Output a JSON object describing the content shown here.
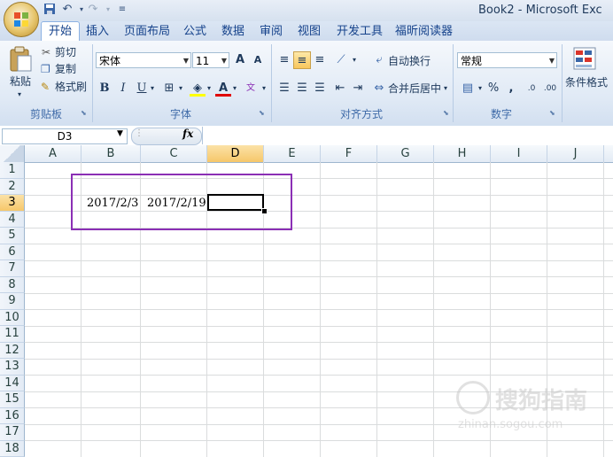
{
  "window": {
    "title": "Book2 - Microsoft Exc"
  },
  "tabs": [
    "开始",
    "插入",
    "页面布局",
    "公式",
    "数据",
    "审阅",
    "视图",
    "开发工具",
    "福昕阅读器"
  ],
  "ribbon": {
    "clipboard": {
      "paste": "粘贴",
      "cut": "剪切",
      "copy": "复制",
      "format_painter": "格式刷",
      "label": "剪贴板"
    },
    "font": {
      "name": "宋体",
      "size": "11",
      "bold": "B",
      "italic": "I",
      "underline": "U",
      "grow": "A",
      "shrink": "A",
      "label": "字体"
    },
    "alignment": {
      "wrap": "自动换行",
      "merge": "合并后居中",
      "label": "对齐方式"
    },
    "number": {
      "format": "常规",
      "percent": "%",
      "comma": ",",
      "inc_decimal": ".0",
      "dec_decimal": ".00",
      "label": "数字"
    },
    "styles": {
      "conditional": "条件格式"
    }
  },
  "formula_bar": {
    "name_box": "D3",
    "fx": "fx",
    "value": ""
  },
  "sheet": {
    "columns": [
      "A",
      "B",
      "C",
      "D",
      "E",
      "F",
      "G",
      "H",
      "I",
      "J"
    ],
    "rows": [
      "1",
      "2",
      "3",
      "4",
      "5",
      "6",
      "7",
      "8",
      "9",
      "10",
      "11",
      "12",
      "13",
      "14",
      "15",
      "16",
      "17",
      "18"
    ],
    "active_cell": "D3",
    "cells": {
      "B3": "2017/2/3",
      "C3": "2017/2/19"
    }
  },
  "colors": {
    "highlight_box": "#8b2fb5",
    "selected_header": "#f6c76a"
  },
  "watermark": {
    "text": "搜狗指南",
    "url_text": "zhinan.sogou.com"
  }
}
